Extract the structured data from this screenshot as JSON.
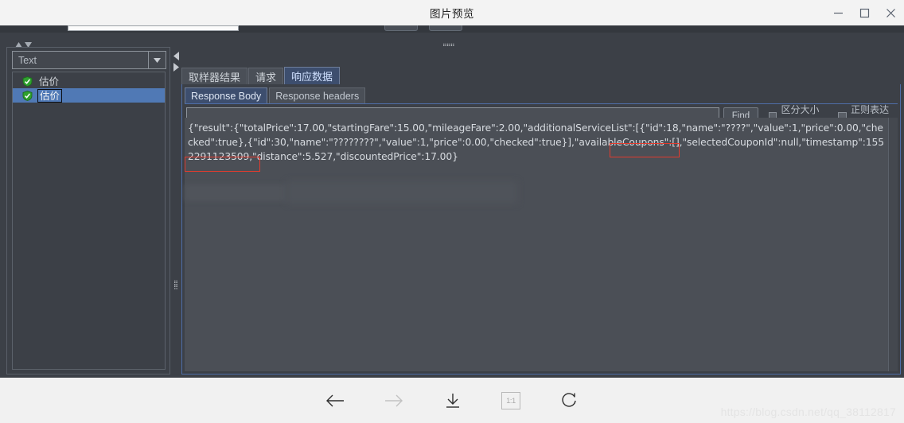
{
  "window": {
    "title": "图片预览",
    "controls": [
      {
        "name": "minimize",
        "glyph": "minimize-icon"
      },
      {
        "name": "maximize",
        "glyph": "maximize-icon"
      },
      {
        "name": "close",
        "glyph": "close-icon"
      }
    ]
  },
  "left_panel": {
    "type_select": {
      "value": "Text",
      "arrow": "chevron-down-icon"
    },
    "tree_items": [
      {
        "label": "估价",
        "status": "success",
        "selected": false
      },
      {
        "label": "估价",
        "status": "success",
        "selected": true
      }
    ]
  },
  "right_panel": {
    "main_tabs": [
      {
        "label": "取样器结果",
        "active": false
      },
      {
        "label": "请求",
        "active": false
      },
      {
        "label": "响应数据",
        "active": true
      }
    ],
    "sub_tabs": [
      {
        "label": "Response Body",
        "active": true
      },
      {
        "label": "Response headers",
        "active": false
      }
    ],
    "find_bar": {
      "input_value": "",
      "input_placeholder": "",
      "find_label": "Find",
      "case_sensitive_label": "区分大小写",
      "case_sensitive_checked": false,
      "regex_label": "正则表达式",
      "regex_checked": false
    },
    "response_body": "{\"result\":{\"totalPrice\":17.00,\"startingFare\":15.00,\"mileageFare\":2.00,\"additionalServiceList\":[{\"id\":18,\"name\":\"????\",\"value\":1,\"price\":0.00,\"checked\":true},{\"id\":30,\"name\":\"????????\",\"value\":1,\"price\":0.00,\"checked\":true}],\"availableCoupons\":[],\"selectedCouponId\":null,\"timestamp\":1552291123509,\"distance\":5.527,\"discountedPrice\":17.00}"
  },
  "bottom_toolbar": {
    "buttons": [
      {
        "name": "previous-image",
        "icon": "arrow-left-icon",
        "enabled": true
      },
      {
        "name": "next-image",
        "icon": "arrow-right-icon",
        "enabled": false
      },
      {
        "name": "download-image",
        "icon": "download-icon",
        "enabled": true
      },
      {
        "name": "actual-size",
        "icon": "one-to-one-icon",
        "label": "1:1",
        "enabled": true
      },
      {
        "name": "rotate-image",
        "icon": "rotate-icon",
        "enabled": true
      }
    ]
  },
  "watermark": "https://blog.csdn.net/qq_38112817"
}
